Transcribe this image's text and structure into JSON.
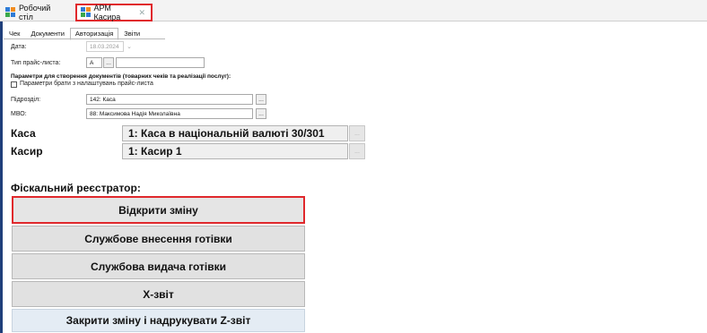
{
  "window_tabs": [
    {
      "label": "Робочий стіл"
    },
    {
      "label": "АРМ Касира"
    }
  ],
  "inner_tabs": [
    "Чек",
    "Документи",
    "Авторизація",
    "Звіти"
  ],
  "form": {
    "date_label": "Дата:",
    "date_value": "18.03.2024",
    "price_type_label": "Тип прайс-листа:",
    "price_type_value": "А",
    "price_type_extra": "",
    "params_heading": "Параметри для створення документів (товарних чеків та реалізації послуг):",
    "params_checkbox_label": "Параметри брати з налаштувань прайс-листа",
    "params_checkbox_checked": false,
    "subdivision_label": "Підрозділ:",
    "subdivision_value": "142: Каса",
    "mvo_label": "МВО:",
    "mvo_value": "88: Максимова Надія Миколаївна",
    "dots": "..."
  },
  "cash": {
    "kasa_label": "Каса",
    "kasa_value": "1: Каса в національній валюті 30/301",
    "kasyr_label": "Касир",
    "kasyr_value": "1: Касир 1"
  },
  "fiscal": {
    "heading": "Фіскальний реєстратор:",
    "buttons": [
      "Відкрити зміну",
      "Службове внесення готівки",
      "Службова видача готівки",
      "Х-звіт",
      "Закрити зміну і надрукувати Z-звіт"
    ]
  },
  "colors": {
    "highlight": "#e0282c",
    "accent": "#1f3f7a"
  }
}
